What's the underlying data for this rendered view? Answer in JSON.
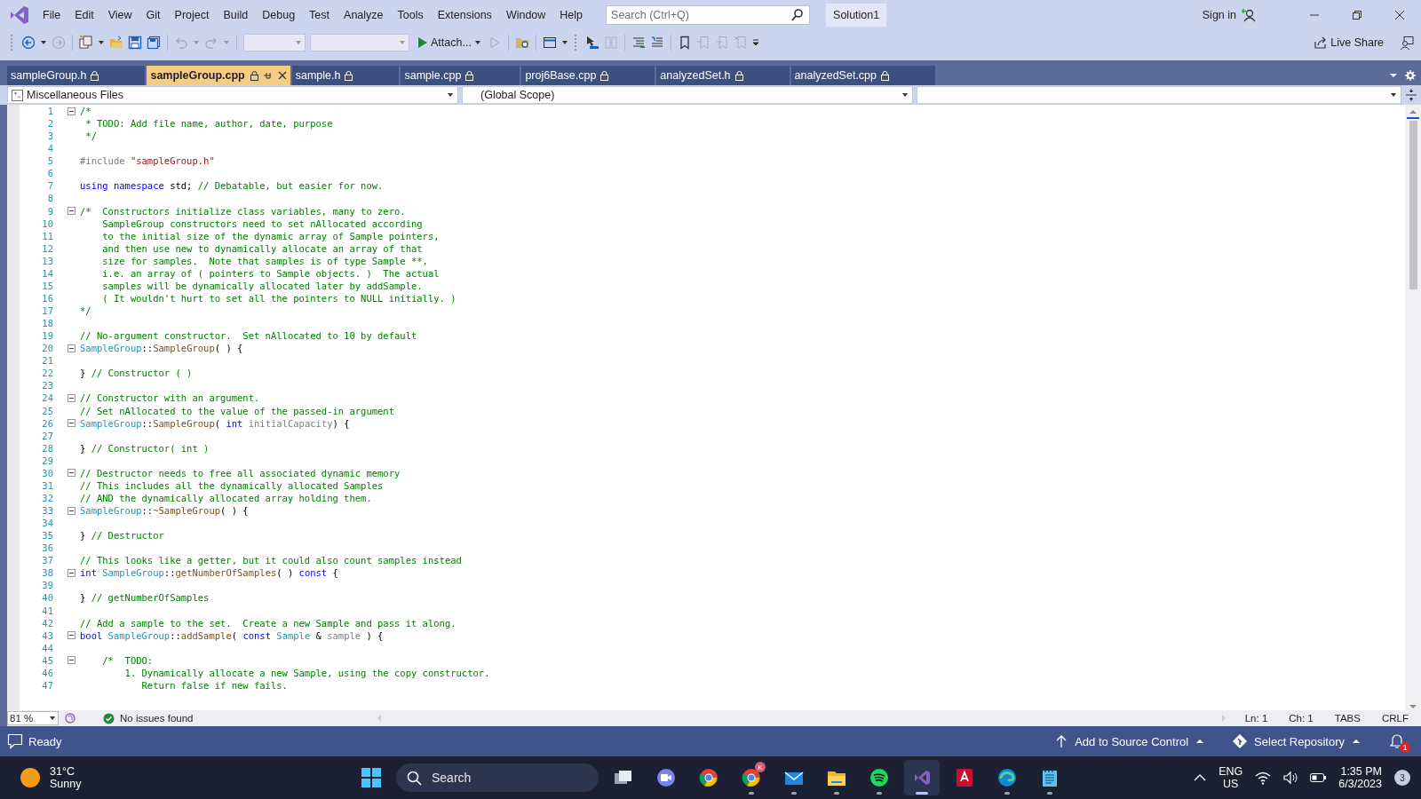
{
  "title_bar": {
    "menu": [
      "File",
      "Edit",
      "View",
      "Git",
      "Project",
      "Build",
      "Debug",
      "Test",
      "Analyze",
      "Tools",
      "Extensions",
      "Window",
      "Help"
    ],
    "search": {
      "placeholder": "Search (Ctrl+Q)"
    },
    "solution": "Solution1",
    "sign_in": "Sign in"
  },
  "toolbar": {
    "attach": "Attach...",
    "live_share": "Live Share"
  },
  "tabs": [
    {
      "label": "sampleGroup.h",
      "selected": false,
      "locked": true
    },
    {
      "label": "sampleGroup.cpp",
      "selected": true,
      "locked": true
    },
    {
      "label": "sample.h",
      "selected": false,
      "locked": true
    },
    {
      "label": "sample.cpp",
      "selected": false,
      "locked": true
    },
    {
      "label": "proj6Base.cpp",
      "selected": false,
      "locked": true
    },
    {
      "label": "analyzedSet.h",
      "selected": false,
      "locked": true
    },
    {
      "label": "analyzedSet.cpp",
      "selected": false,
      "locked": true
    }
  ],
  "navigation_bar": {
    "project": "Miscellaneous Files",
    "scope": "(Global Scope)"
  },
  "editor": {
    "lines": [
      {
        "number": "1",
        "foldable": true,
        "tokens": [
          {
            "kind": "comment",
            "text": "/*"
          }
        ]
      },
      {
        "number": "2",
        "foldable": false,
        "tokens": [
          {
            "kind": "comment",
            "text": " * TODO: Add file name, author, date, purpose"
          }
        ]
      },
      {
        "number": "3",
        "foldable": false,
        "tokens": [
          {
            "kind": "comment",
            "text": " */"
          }
        ]
      },
      {
        "number": "4",
        "foldable": false
      },
      {
        "number": "5",
        "foldable": false,
        "tokens": [
          {
            "kind": "preproc",
            "text": "#include "
          },
          {
            "kind": "string",
            "text": "\"sampleGroup.h\""
          }
        ]
      },
      {
        "number": "6",
        "foldable": false
      },
      {
        "number": "7",
        "foldable": false,
        "tokens": [
          {
            "kind": "keyword",
            "text": "using"
          },
          {
            "kind": "keyword",
            "text": " namespace"
          },
          {
            "kind": "plain",
            "text": " std; "
          },
          {
            "kind": "comment",
            "text": "// Debatable, but easier for now."
          }
        ]
      },
      {
        "number": "8",
        "foldable": false
      },
      {
        "number": "9",
        "foldable": true,
        "tokens": [
          {
            "kind": "comment",
            "text": "/*  Constructors initialize class variables, many to zero."
          }
        ]
      },
      {
        "number": "10",
        "foldable": false,
        "tokens": [
          {
            "kind": "comment",
            "text": "    SampleGroup constructors need to set nAllocated according"
          }
        ]
      },
      {
        "number": "11",
        "foldable": false,
        "tokens": [
          {
            "kind": "comment",
            "text": "    to the initial size of the dynamic array of Sample pointers,"
          }
        ]
      },
      {
        "number": "12",
        "foldable": false,
        "tokens": [
          {
            "kind": "comment",
            "text": "    and then use new to dynamically allocate an array of that"
          }
        ]
      },
      {
        "number": "13",
        "foldable": false,
        "tokens": [
          {
            "kind": "comment",
            "text": "    size for samples.  Note that samples is of type Sample **,"
          }
        ]
      },
      {
        "number": "14",
        "foldable": false,
        "tokens": [
          {
            "kind": "comment",
            "text": "    i.e. an array of ( pointers to Sample objects. )  The actual"
          }
        ]
      },
      {
        "number": "15",
        "foldable": false,
        "tokens": [
          {
            "kind": "comment",
            "text": "    samples will be dynamically allocated later by addSample."
          }
        ]
      },
      {
        "number": "16",
        "foldable": false,
        "tokens": [
          {
            "kind": "comment",
            "text": "    ( It wouldn't hurt to set all the pointers to NULL initially. )"
          }
        ]
      },
      {
        "number": "17",
        "foldable": false,
        "tokens": [
          {
            "kind": "comment",
            "text": "*/"
          }
        ]
      },
      {
        "number": "18",
        "foldable": false
      },
      {
        "number": "19",
        "foldable": false,
        "tokens": [
          {
            "kind": "comment",
            "text": "// No-argument constructor.  Set nAllocated to 10 by default"
          }
        ]
      },
      {
        "number": "20",
        "foldable": true,
        "tokens": [
          {
            "kind": "type",
            "text": "SampleGroup"
          },
          {
            "kind": "plain",
            "text": "::"
          },
          {
            "kind": "function",
            "text": "SampleGroup"
          },
          {
            "kind": "plain",
            "text": "( ) {"
          }
        ]
      },
      {
        "number": "21",
        "foldable": false
      },
      {
        "number": "22",
        "foldable": false,
        "tokens": [
          {
            "kind": "plain",
            "text": "} "
          },
          {
            "kind": "comment",
            "text": "// Constructor ( )"
          }
        ]
      },
      {
        "number": "23",
        "foldable": false
      },
      {
        "number": "24",
        "foldable": true,
        "tokens": [
          {
            "kind": "comment",
            "text": "// Constructor with an argument."
          }
        ]
      },
      {
        "number": "25",
        "foldable": false,
        "tokens": [
          {
            "kind": "comment",
            "text": "// Set nAllocated to the value of the passed-in argument"
          }
        ]
      },
      {
        "number": "26",
        "foldable": true,
        "tokens": [
          {
            "kind": "type",
            "text": "SampleGroup"
          },
          {
            "kind": "plain",
            "text": "::"
          },
          {
            "kind": "function",
            "text": "SampleGroup"
          },
          {
            "kind": "plain",
            "text": "( "
          },
          {
            "kind": "keyword",
            "text": "int"
          },
          {
            "kind": "parameter",
            "text": " initialCapacity"
          },
          {
            "kind": "plain",
            "text": ") {"
          }
        ]
      },
      {
        "number": "27",
        "foldable": false
      },
      {
        "number": "28",
        "foldable": false,
        "tokens": [
          {
            "kind": "plain",
            "text": "} "
          },
          {
            "kind": "comment",
            "text": "// Constructor( int )"
          }
        ]
      },
      {
        "number": "29",
        "foldable": false
      },
      {
        "number": "30",
        "foldable": true,
        "tokens": [
          {
            "kind": "comment",
            "text": "// Destructor needs to free all associated dynamic memory"
          }
        ]
      },
      {
        "number": "31",
        "foldable": false,
        "tokens": [
          {
            "kind": "comment",
            "text": "// This includes all the dynamically allocated Samples"
          }
        ]
      },
      {
        "number": "32",
        "foldable": false,
        "tokens": [
          {
            "kind": "comment",
            "text": "// AND the dynamically allocated array holding them."
          }
        ]
      },
      {
        "number": "33",
        "foldable": true,
        "tokens": [
          {
            "kind": "type",
            "text": "SampleGroup"
          },
          {
            "kind": "plain",
            "text": "::"
          },
          {
            "kind": "function",
            "text": "~SampleGroup"
          },
          {
            "kind": "plain",
            "text": "( ) {"
          }
        ]
      },
      {
        "number": "34",
        "foldable": false
      },
      {
        "number": "35",
        "foldable": false,
        "tokens": [
          {
            "kind": "plain",
            "text": "} "
          },
          {
            "kind": "comment",
            "text": "// Destructor"
          }
        ]
      },
      {
        "number": "36",
        "foldable": false
      },
      {
        "number": "37",
        "foldable": false,
        "tokens": [
          {
            "kind": "comment",
            "text": "// This looks like a getter, but it could also count samples instead"
          }
        ]
      },
      {
        "number": "38",
        "foldable": true,
        "tokens": [
          {
            "kind": "keyword",
            "text": "int"
          },
          {
            "kind": "type",
            "text": " SampleGroup"
          },
          {
            "kind": "plain",
            "text": "::"
          },
          {
            "kind": "function",
            "text": "getNumberOfSamples"
          },
          {
            "kind": "plain",
            "text": "( ) "
          },
          {
            "kind": "keyword",
            "text": "const"
          },
          {
            "kind": "plain",
            "text": " {"
          }
        ]
      },
      {
        "number": "39",
        "foldable": false
      },
      {
        "number": "40",
        "foldable": false,
        "tokens": [
          {
            "kind": "plain",
            "text": "} "
          },
          {
            "kind": "comment",
            "text": "// getNumberOfSamples"
          }
        ]
      },
      {
        "number": "41",
        "foldable": false
      },
      {
        "number": "42",
        "foldable": false,
        "tokens": [
          {
            "kind": "comment",
            "text": "// Add a sample to the set.  Create a new Sample and pass it along."
          }
        ]
      },
      {
        "number": "43",
        "foldable": true,
        "tokens": [
          {
            "kind": "keyword",
            "text": "bool"
          },
          {
            "kind": "type",
            "text": " SampleGroup"
          },
          {
            "kind": "plain",
            "text": "::"
          },
          {
            "kind": "function",
            "text": "addSample"
          },
          {
            "kind": "plain",
            "text": "( "
          },
          {
            "kind": "keyword",
            "text": "const"
          },
          {
            "kind": "type",
            "text": " Sample"
          },
          {
            "kind": "plain",
            "text": " & "
          },
          {
            "kind": "parameter",
            "text": "sample"
          },
          {
            "kind": "plain",
            "text": " ) {"
          }
        ]
      },
      {
        "number": "44",
        "foldable": false
      },
      {
        "number": "45",
        "foldable": true,
        "tokens": [
          {
            "kind": "comment",
            "text": "    /*  TODO:"
          }
        ]
      },
      {
        "number": "46",
        "foldable": false,
        "tokens": [
          {
            "kind": "comment",
            "text": "        1. Dynamically allocate a new Sample, using the copy constructor."
          }
        ]
      },
      {
        "number": "47",
        "foldable": false,
        "tokens": [
          {
            "kind": "comment",
            "text": "           Return false if new fails."
          }
        ]
      }
    ]
  },
  "editor_status": {
    "zoom": "81 %",
    "issues": "No issues found",
    "line": "Ln: 1",
    "column": "Ch: 1",
    "indent": "TABS",
    "line_ending": "CRLF"
  },
  "status_bar": {
    "state": "Ready",
    "source_control": "Add to Source Control",
    "repository": "Select Repository",
    "notifications": "1"
  },
  "taskbar": {
    "weather": {
      "temperature": "31°C",
      "condition": "Sunny"
    },
    "search": {
      "placeholder": "Search"
    },
    "apps": [
      {
        "kind": "task-view",
        "running": false,
        "selected": false
      },
      {
        "kind": "video-call",
        "running": false,
        "selected": false
      },
      {
        "kind": "browser",
        "running": false,
        "selected": false
      },
      {
        "kind": "browser",
        "running": true,
        "selected": false,
        "badge": "K"
      },
      {
        "kind": "mail",
        "running": true,
        "selected": false
      },
      {
        "kind": "folder",
        "running": true,
        "selected": false
      },
      {
        "kind": "music",
        "running": true,
        "selected": false
      },
      {
        "kind": "ide",
        "running": true,
        "selected": true
      },
      {
        "kind": "cad",
        "running": false,
        "selected": false
      },
      {
        "kind": "edge-browser",
        "running": true,
        "selected": false
      },
      {
        "kind": "notepad",
        "running": true,
        "selected": false
      }
    ],
    "language": "ENG",
    "region": "US",
    "time": "1:35 PM",
    "date": "6/3/2023",
    "notification_count": "3"
  }
}
